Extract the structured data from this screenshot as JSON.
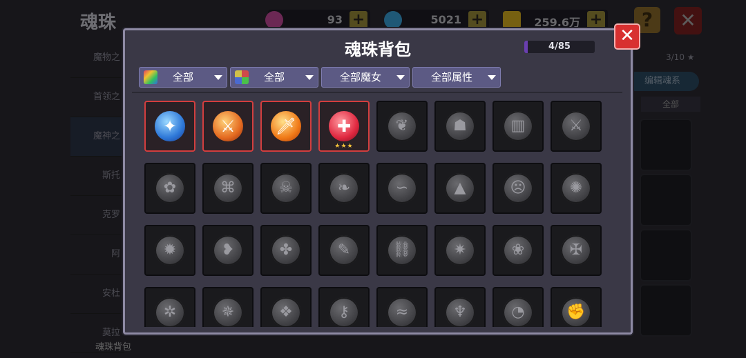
{
  "background_page": {
    "title": "魂珠",
    "currencies": [
      {
        "name": "gem-pink",
        "amount": "93",
        "color": "#c44a9a"
      },
      {
        "name": "gem-blue",
        "amount": "5021",
        "color": "#3aa0d8"
      },
      {
        "name": "gold",
        "amount": "259.6万",
        "color": "#d8b020"
      }
    ],
    "help_glyph": "?",
    "close_glyph": "✕",
    "side_items": [
      "魔物之",
      "首领之",
      "魔神之",
      "斯托",
      "克罗",
      "阿",
      "安杜",
      "莫拉"
    ],
    "right_count": "3/10 ★",
    "right_button": "编辑魂系",
    "right_select": "全部",
    "bottom_label": "魂珠背包"
  },
  "modal": {
    "title": "魂珠背包",
    "capacity": "4/85",
    "capacity_fraction": 0.047,
    "close_glyph": "✕",
    "filters": [
      {
        "label": "全部",
        "icon": "rainbow-square-icon"
      },
      {
        "label": "全部",
        "icon": "four-color-grid-icon"
      },
      {
        "label": "全部魔女",
        "icon": ""
      },
      {
        "label": "全部属性",
        "icon": ""
      }
    ],
    "slots": [
      {
        "owned": true,
        "icon": "blue-crystal-orb-icon",
        "glyph": "✦",
        "style": "o1",
        "stars": ""
      },
      {
        "owned": true,
        "icon": "orange-drill-orb-icon",
        "glyph": "⚔",
        "style": "o2",
        "stars": ""
      },
      {
        "owned": true,
        "icon": "golden-sword-orb-icon",
        "glyph": "🗡",
        "style": "o3",
        "stars": ""
      },
      {
        "owned": true,
        "icon": "red-staff-orb-icon",
        "glyph": "✚",
        "style": "o4",
        "stars": "★★★"
      },
      {
        "owned": false,
        "icon": "locked-claw-icon",
        "glyph": "❦"
      },
      {
        "owned": false,
        "icon": "locked-helmet-icon",
        "glyph": "☗"
      },
      {
        "owned": false,
        "icon": "locked-book-icon",
        "glyph": "▥"
      },
      {
        "owned": false,
        "icon": "locked-sword-icon",
        "glyph": "⚔"
      },
      {
        "owned": false,
        "icon": "locked-flower-icon",
        "glyph": "✿"
      },
      {
        "owned": false,
        "icon": "locked-rune-icon",
        "glyph": "⌘"
      },
      {
        "owned": false,
        "icon": "locked-skull-icon",
        "glyph": "☠"
      },
      {
        "owned": false,
        "icon": "locked-fish-icon",
        "glyph": "❧"
      },
      {
        "owned": false,
        "icon": "locked-snake-icon",
        "glyph": "∽"
      },
      {
        "owned": false,
        "icon": "locked-witch-hat-icon",
        "glyph": "▲"
      },
      {
        "owned": false,
        "icon": "locked-mask-icon",
        "glyph": "☹"
      },
      {
        "owned": false,
        "icon": "locked-beast-icon",
        "glyph": "✺"
      },
      {
        "owned": false,
        "icon": "locked-gear-icon",
        "glyph": "✹"
      },
      {
        "owned": false,
        "icon": "locked-feather-icon",
        "glyph": "❥"
      },
      {
        "owned": false,
        "icon": "locked-clover-icon",
        "glyph": "✤"
      },
      {
        "owned": false,
        "icon": "locked-wand-icon",
        "glyph": "✎"
      },
      {
        "owned": false,
        "icon": "locked-chain-icon",
        "glyph": "⛓"
      },
      {
        "owned": false,
        "icon": "locked-star-icon",
        "glyph": "✷"
      },
      {
        "owned": false,
        "icon": "locked-vine-icon",
        "glyph": "❀"
      },
      {
        "owned": false,
        "icon": "locked-cross-icon",
        "glyph": "✠"
      },
      {
        "owned": false,
        "icon": "locked-crab-icon",
        "glyph": "✲"
      },
      {
        "owned": false,
        "icon": "locked-dragon-icon",
        "glyph": "✵"
      },
      {
        "owned": false,
        "icon": "locked-knot-icon",
        "glyph": "❖"
      },
      {
        "owned": false,
        "icon": "locked-key-icon",
        "glyph": "⚷"
      },
      {
        "owned": false,
        "icon": "locked-lizard-icon",
        "glyph": "≈"
      },
      {
        "owned": false,
        "icon": "locked-bat-icon",
        "glyph": "♆"
      },
      {
        "owned": false,
        "icon": "locked-wave-icon",
        "glyph": "◔"
      },
      {
        "owned": false,
        "icon": "locked-fist-icon",
        "glyph": "✊"
      }
    ]
  }
}
